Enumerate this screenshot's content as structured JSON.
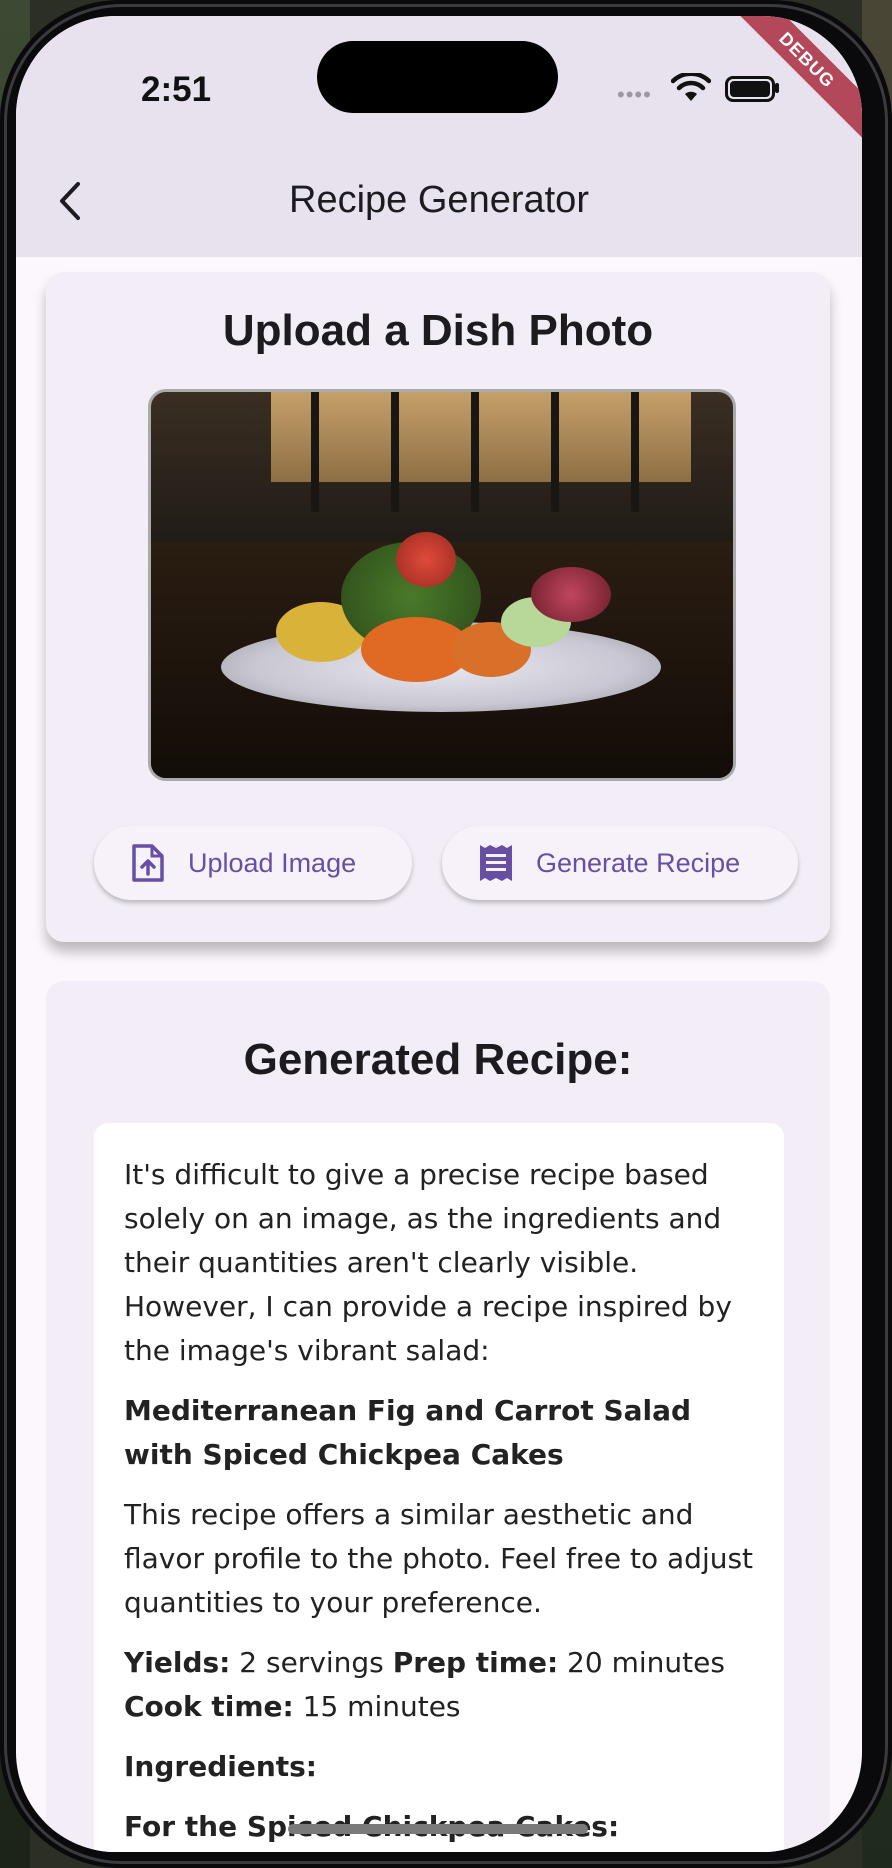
{
  "status_bar": {
    "time": "2:51",
    "signal_dots": "••••",
    "debug_label": "DEBUG"
  },
  "app_bar": {
    "title": "Recipe Generator",
    "back_icon": "chevron-left-icon"
  },
  "upload_card": {
    "heading": "Upload a Dish Photo",
    "upload_button": "Upload Image",
    "generate_button": "Generate Recipe"
  },
  "recipe_card": {
    "heading": "Generated Recipe:",
    "intro": "It's difficult to give a precise recipe based solely on an image, as the ingredients and their quantities aren't clearly visible. However, I can provide a recipe inspired by the image's vibrant salad:",
    "recipe_title": "Mediterranean Fig and Carrot Salad with Spiced Chickpea Cakes",
    "description": "This recipe offers a similar aesthetic and flavor profile to the photo. Feel free to adjust quantities to your preference.",
    "yields_label": "Yields:",
    "yields_value": " 2 servings ",
    "prep_label": "Prep time:",
    "prep_value": " 20 minutes",
    "cook_label": "Cook time:",
    "cook_value": " 15 minutes",
    "ingredients_label": "Ingredients:",
    "sub_section": "For the Spiced Chickpea Cakes:"
  },
  "colors": {
    "accent": "#6750a4",
    "app_bar_bg": "#e8e2ee",
    "card_bg": "#f2edf6",
    "debug_ribbon": "#b3485a"
  }
}
